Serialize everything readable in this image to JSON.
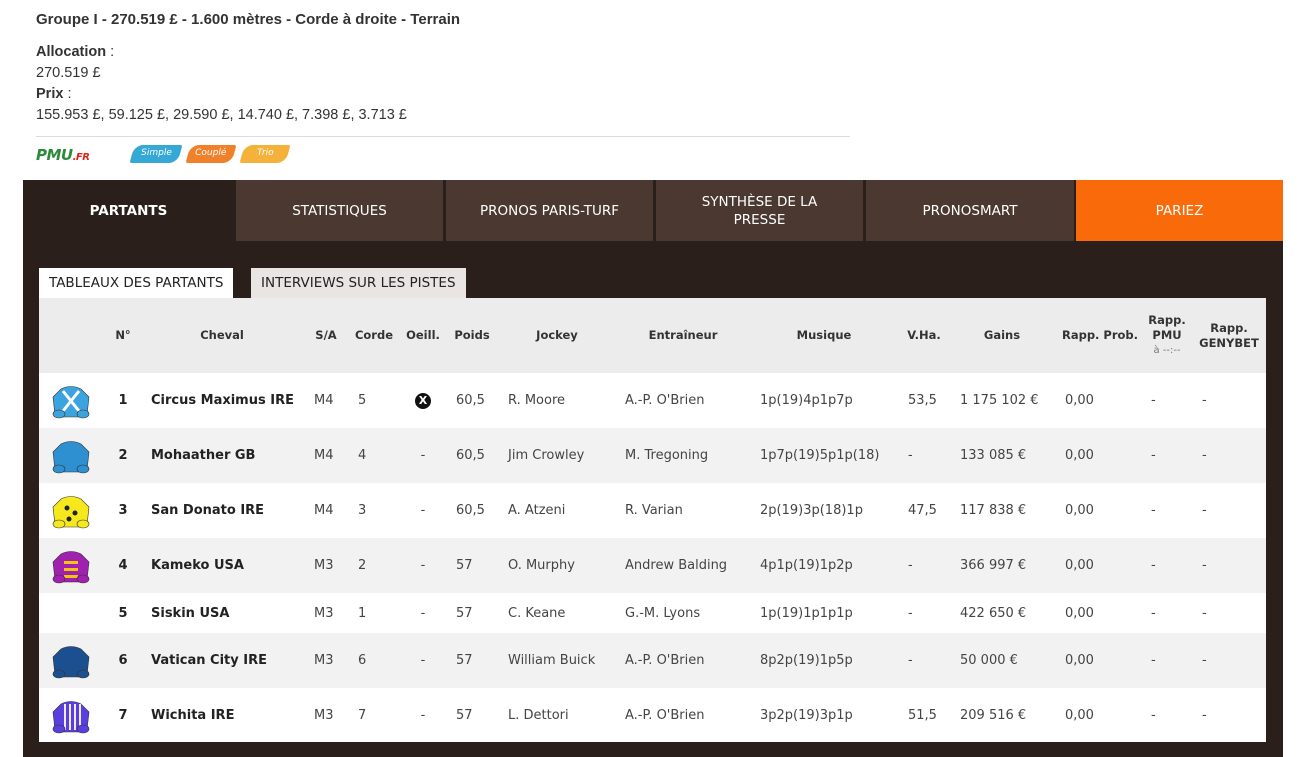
{
  "race": {
    "title": "Groupe I - 270.519 £ - 1.600 mètres - Corde à droite - Terrain",
    "allocation_label": "Allocation",
    "allocation_value": "270.519 £",
    "prix_label": "Prix",
    "prix_value": "155.953 £, 59.125 £, 29.590 £, 14.740 £, 7.398 £, 3.713 £",
    "colon": " :"
  },
  "bet_types": {
    "logo_main": "PMU",
    "logo_suffix": ".FR",
    "simple": "Simple",
    "couple": "Couplé",
    "trio": "Trio"
  },
  "tabs": [
    {
      "label": "PARTANTS",
      "active": true
    },
    {
      "label": "STATISTIQUES"
    },
    {
      "label": "PRONOS PARIS-TURF"
    },
    {
      "label": "SYNTHÈSE DE LA PRESSE"
    },
    {
      "label": "PRONOSMART"
    },
    {
      "label": "PARIEZ"
    }
  ],
  "subtabs": [
    {
      "label": "TABLEAUX DES PARTANTS",
      "active": true
    },
    {
      "label": "INTERVIEWS SUR LES PISTES"
    }
  ],
  "table": {
    "headers": {
      "num": "N°",
      "cheval": "Cheval",
      "sa": "S/A",
      "corde": "Corde",
      "oeill": "Oeill.",
      "poids": "Poids",
      "jockey": "Jockey",
      "entraineur": "Entraîneur",
      "musique": "Musique",
      "vha": "V.Ha.",
      "gains": "Gains",
      "rapp_prob": "Rapp. Prob.",
      "rapp_pmu": "Rapp. PMU",
      "rapp_pmu_time": "à --:--",
      "rapp_genybet": "Rapp. GENYBET"
    },
    "rows": [
      {
        "num": "1",
        "cheval": "Circus Maximus IRE",
        "sa": "M4",
        "corde": "5",
        "oeill": "X",
        "poids": "60,5",
        "jockey": "R. Moore",
        "entraineur": "A.-P. O'Brien",
        "musique": "1p(19)4p1p7p",
        "vha": "53,5",
        "gains": "1 175 102 €",
        "rapp_prob": "0,00",
        "rapp_pmu": "-",
        "rapp_genybet": "-",
        "silk": "light-blue-cross-icon"
      },
      {
        "num": "2",
        "cheval": "Mohaather GB",
        "sa": "M4",
        "corde": "4",
        "oeill": "-",
        "poids": "60,5",
        "jockey": "Jim Crowley",
        "entraineur": "M. Tregoning",
        "musique": "1p7p(19)5p1p(18)",
        "vha": "-",
        "gains": "133 085 €",
        "rapp_prob": "0,00",
        "rapp_pmu": "-",
        "rapp_genybet": "-",
        "silk": "blue-silk-icon"
      },
      {
        "num": "3",
        "cheval": "San Donato IRE",
        "sa": "M4",
        "corde": "3",
        "oeill": "-",
        "poids": "60,5",
        "jockey": "A. Atzeni",
        "entraineur": "R. Varian",
        "musique": "2p(19)3p(18)1p",
        "vha": "47,5",
        "gains": "117 838 €",
        "rapp_prob": "0,00",
        "rapp_pmu": "-",
        "rapp_genybet": "-",
        "silk": "yellow-spotted-silk-icon"
      },
      {
        "num": "4",
        "cheval": "Kameko USA",
        "sa": "M3",
        "corde": "2",
        "oeill": "-",
        "poids": "57",
        "jockey": "O. Murphy",
        "entraineur": "Andrew Balding",
        "musique": "4p1p(19)1p2p",
        "vha": "-",
        "gains": "366 997 €",
        "rapp_prob": "0,00",
        "rapp_pmu": "-",
        "rapp_genybet": "-",
        "silk": "purple-silk-icon"
      },
      {
        "num": "5",
        "cheval": "Siskin USA",
        "sa": "M3",
        "corde": "1",
        "oeill": "-",
        "poids": "57",
        "jockey": "C. Keane",
        "entraineur": "G.-M. Lyons",
        "musique": "1p(19)1p1p1p",
        "vha": "-",
        "gains": "422 650 €",
        "rapp_prob": "0,00",
        "rapp_pmu": "-",
        "rapp_genybet": "-",
        "silk": ""
      },
      {
        "num": "6",
        "cheval": "Vatican City IRE",
        "sa": "M3",
        "corde": "6",
        "oeill": "-",
        "poids": "57",
        "jockey": "William Buick",
        "entraineur": "A.-P. O'Brien",
        "musique": "8p2p(19)1p5p",
        "vha": "-",
        "gains": "50 000 €",
        "rapp_prob": "0,00",
        "rapp_pmu": "-",
        "rapp_genybet": "-",
        "silk": "navy-silk-icon"
      },
      {
        "num": "7",
        "cheval": "Wichita IRE",
        "sa": "M3",
        "corde": "7",
        "oeill": "-",
        "poids": "57",
        "jockey": "L. Dettori",
        "entraineur": "A.-P. O'Brien",
        "musique": "3p2p(19)3p1p",
        "vha": "51,5",
        "gains": "209 516 €",
        "rapp_prob": "0,00",
        "rapp_pmu": "-",
        "rapp_genybet": "-",
        "silk": "violet-striped-silk-icon"
      }
    ]
  },
  "colors": {
    "panel_bg": "#2a1f1b",
    "tab_bg": "#4a3831",
    "bet_tab": "#f96b0a",
    "row_alt": "#f2f2f2",
    "header_bg": "#ececec"
  }
}
